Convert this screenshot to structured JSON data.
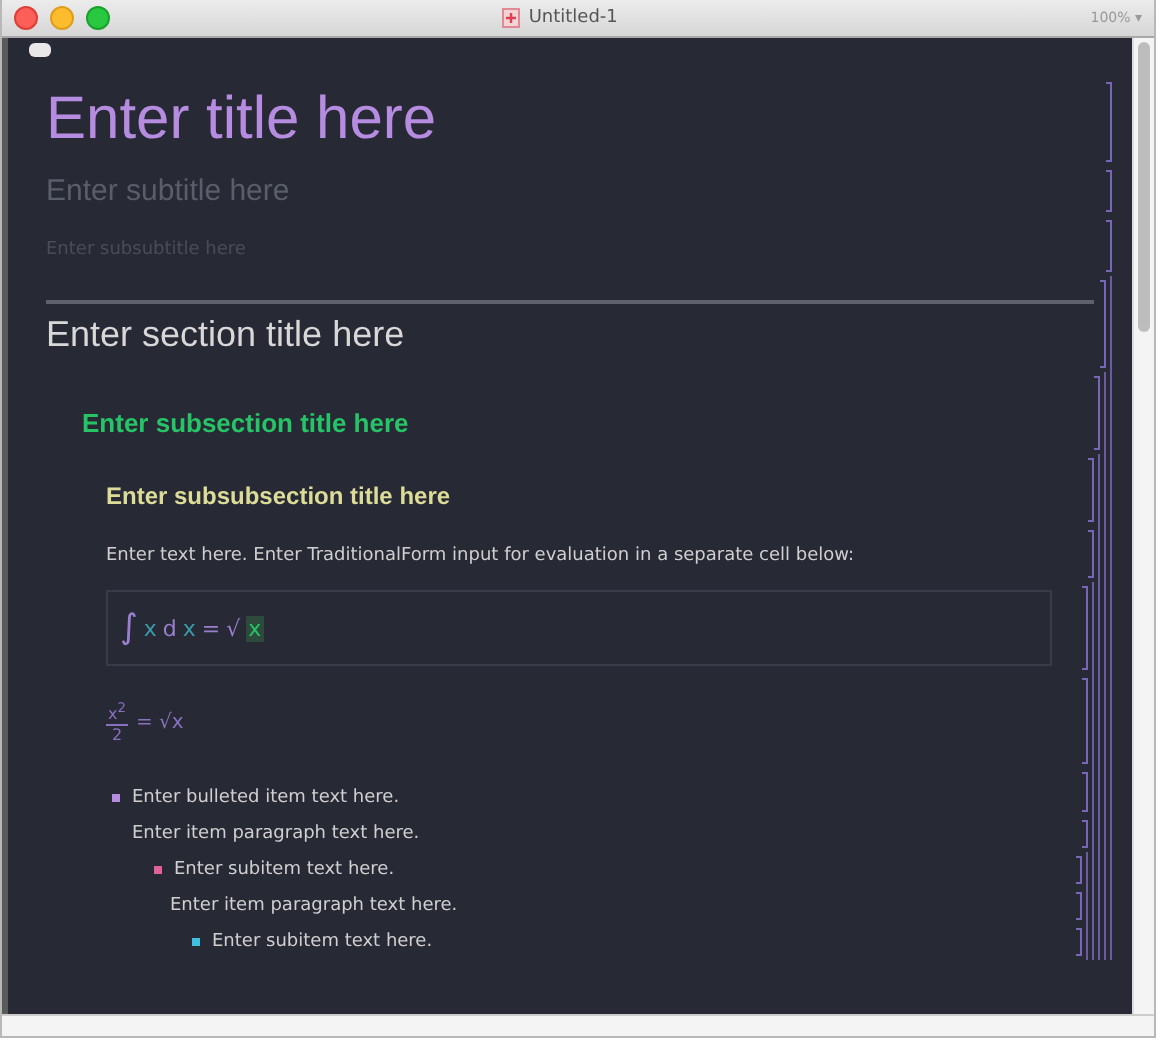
{
  "window": {
    "title": "Untitled-1",
    "zoom": "100% ▾"
  },
  "cells": [
    {
      "kind": "title",
      "text": "Enter title here"
    },
    {
      "kind": "subtitle",
      "text": "Enter subtitle here"
    },
    {
      "kind": "subsubtitle",
      "text": "Enter subsubtitle here"
    },
    {
      "kind": "section",
      "text": "Enter section title here",
      "children": [
        {
          "kind": "subsection",
          "text": "Enter subsection title here",
          "children": [
            {
              "kind": "subsubsection",
              "text": "Enter subsubsection title here",
              "children": [
                {
                  "kind": "text",
                  "text": "Enter text here. Enter TraditionalForm input for evaluation in a separate cell below:"
                },
                {
                  "kind": "input",
                  "tokens": [
                    {
                      "text": "∫",
                      "kind": "op"
                    },
                    {
                      "text": "x",
                      "kind": "var"
                    },
                    {
                      "text": "d",
                      "kind": "op"
                    },
                    {
                      "text": "x",
                      "kind": "var"
                    },
                    {
                      "text": "=",
                      "kind": "op"
                    },
                    {
                      "text": "√",
                      "kind": "op"
                    },
                    {
                      "text": "x",
                      "kind": "new"
                    }
                  ],
                  "children": [
                    {
                      "kind": "output",
                      "numerator": "x$^{2}$",
                      "denominator": "2",
                      "rhs": "= √x"
                    }
                  ]
                },
                {
                  "kind": "item",
                  "text": "Enter bulleted item text here.",
                  "children": [
                    {
                      "kind": "itemparagraph",
                      "text": "Enter item paragraph text here."
                    },
                    {
                      "kind": "subitem",
                      "text": "Enter subitem text here.",
                      "children": [
                        {
                          "kind": "subitemparagraph",
                          "text": "Enter item paragraph text here."
                        },
                        {
                          "kind": "subsubitem",
                          "text": "Enter subitem text here."
                        }
                      ]
                    }
                  ]
                }
              ]
            }
          ]
        }
      ]
    }
  ]
}
